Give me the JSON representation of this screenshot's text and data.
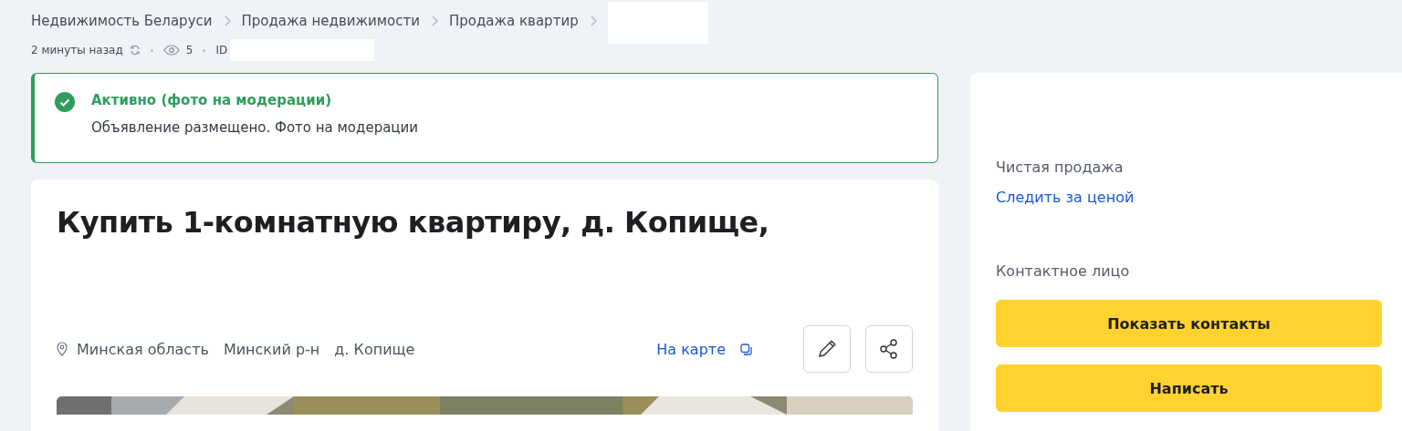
{
  "breadcrumbs": [
    "Недвижимость Беларуси",
    "Продажа недвижимости",
    "Продажа квартир"
  ],
  "meta": {
    "time": "2 минуты назад",
    "views": "5",
    "id_label": "ID"
  },
  "alert": {
    "title": "Активно (фото на модерации)",
    "text": "Объявление размещено. Фото на модерации"
  },
  "listing": {
    "title": "Купить 1-комнатную квартиру, д. Копище,",
    "location": [
      "Минская область",
      "Минский р-н",
      "д. Копище"
    ],
    "map_link": "На карте"
  },
  "sidebar": {
    "sale_type": "Чистая продажа",
    "watch_price": "Следить за ценой",
    "contact_label": "Контактное лицо",
    "buttons": [
      "Показать контакты",
      "Написать"
    ]
  }
}
